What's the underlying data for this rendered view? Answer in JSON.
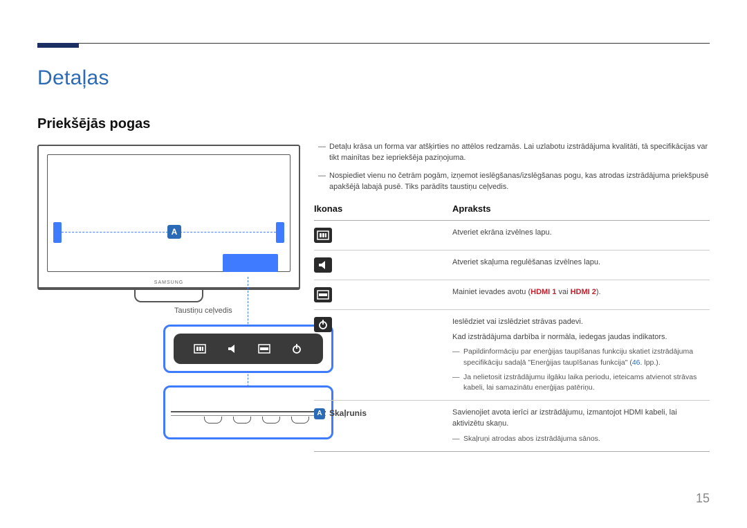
{
  "page": {
    "number": "15"
  },
  "title": "Detaļas",
  "subtitle": "Priekšējās pogas",
  "figure": {
    "caption": "Taustiņu ceļvedis",
    "brand": "SAMSUNG",
    "callout_badge": "A"
  },
  "notes": {
    "n1": "Detaļu krāsa un forma var atšķirties no attēlos redzamās. Lai uzlabotu izstrādājuma kvalitāti, tā specifikācijas var tikt mainītas bez iepriekšēja paziņojuma.",
    "n2": "Nospiediet vienu no četrām pogām, izņemot ieslēgšanas/izslēgšanas pogu, kas atrodas izstrādājuma priekšpusē apakšējā labajā pusē. Tiks parādīts taustiņu ceļvedis."
  },
  "table": {
    "head_icons": "Ikonas",
    "head_desc": "Apraksts",
    "rows": {
      "menu": {
        "desc": "Atveriet ekrāna izvēlnes lapu."
      },
      "volume": {
        "desc": "Atveriet skaļuma regulēšanas izvēlnes lapu."
      },
      "source": {
        "desc_pre": "Mainiet ievades avotu (",
        "hdmi1": "HDMI 1",
        "mid": " vai ",
        "hdmi2": "HDMI 2",
        "desc_post": ")."
      },
      "power": {
        "desc1": "Ieslēdziet vai izslēdziet strāvas padevi.",
        "desc2": "Kad izstrādājuma darbība ir normāla, iedegas jaudas indikators.",
        "sub1_pre": "Papildinformāciju par enerģijas taupīšanas funkciju skatiet izstrādājuma specifikāciju sadaļā \"Enerģijas taupīšanas funkcija\" (",
        "sub1_link": "46",
        "sub1_post": ". lpp.).",
        "sub2": "Ja nelietosit izstrādājumu ilgāku laika periodu, ieteicams atvienot strāvas kabeli, lai samazinātu enerģijas patēriņu."
      },
      "speaker": {
        "badge": "A",
        "label": "Skaļrunis",
        "desc": "Savienojiet avota ierīci ar izstrādājumu, izmantojot HDMI kabeli, lai aktivizētu skaņu.",
        "sub": "Skaļruņi atrodas abos izstrādājuma sānos."
      }
    }
  }
}
